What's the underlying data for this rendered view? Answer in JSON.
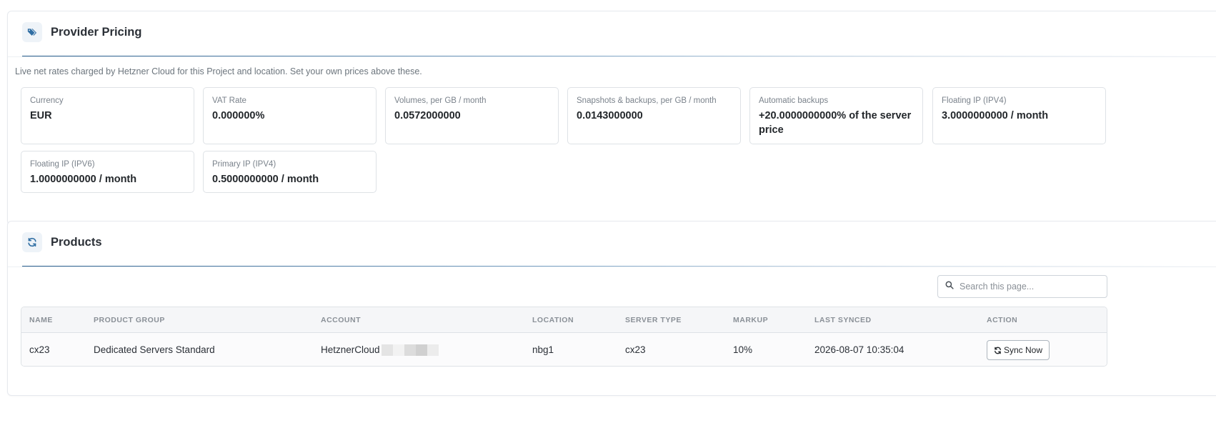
{
  "provider_pricing": {
    "title": "Provider Pricing",
    "icon": "tags-icon",
    "description": "Live net rates charged by Hetzner Cloud for this Project and location. Set your own prices above these.",
    "rates": [
      {
        "label": "Currency",
        "value": "EUR"
      },
      {
        "label": "VAT Rate",
        "value": "0.000000%"
      },
      {
        "label": "Volumes, per GB / month",
        "value": "0.0572000000"
      },
      {
        "label": "Snapshots & backups, per GB / month",
        "value": "0.0143000000"
      },
      {
        "label": "Automatic backups",
        "value": "+20.0000000000% of the server price"
      },
      {
        "label": "Floating IP (IPV4)",
        "value": "3.0000000000 / month"
      },
      {
        "label": "Floating IP (IPV6)",
        "value": "1.0000000000 / month"
      },
      {
        "label": "Primary IP (IPV4)",
        "value": "0.5000000000 / month"
      }
    ]
  },
  "products": {
    "title": "Products",
    "icon": "refresh-icon",
    "search": {
      "placeholder": "Search this page...",
      "value": ""
    },
    "columns": [
      "NAME",
      "PRODUCT GROUP",
      "ACCOUNT",
      "LOCATION",
      "SERVER TYPE",
      "MARKUP",
      "LAST SYNCED",
      "ACTION"
    ],
    "rows": [
      {
        "name": "cx23",
        "product_group": "Dedicated Servers Standard",
        "account": "HetznerCloud",
        "location": "nbg1",
        "server_type": "cx23",
        "markup": "10%",
        "last_synced": "2026-08-07 10:35:04",
        "action": "Sync Now"
      }
    ]
  },
  "colors": {
    "accent": "#2a5f8d",
    "icon_bg": "#eef3f8",
    "border": "#dee2e6"
  }
}
